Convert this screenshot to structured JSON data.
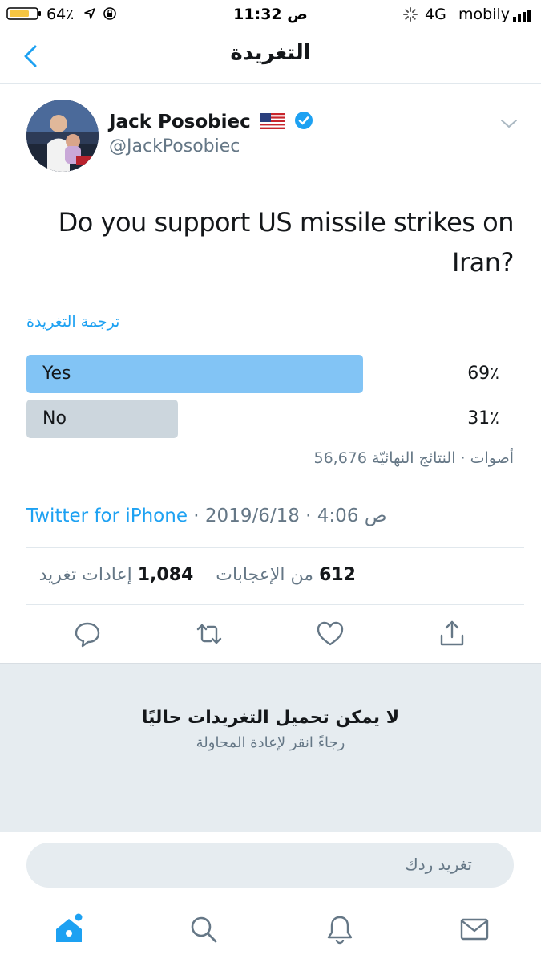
{
  "status_bar": {
    "battery": "64٪",
    "time": "11:32 ص",
    "network": "4G",
    "carrier": "mobily"
  },
  "nav": {
    "title": "التغريدة"
  },
  "tweet": {
    "author_name": "Jack Posobiec",
    "flag": "🇺🇸",
    "handle": "@JackPosobiec",
    "text": "Do you support US missile strikes on Iran?",
    "translate_label": "ترجمة التغريدة",
    "poll": {
      "options": [
        {
          "label": "Yes",
          "percent_text": "69٪",
          "percent": 69,
          "color": "#82c4f5"
        },
        {
          "label": "No",
          "percent_text": "31٪",
          "percent": 31,
          "color": "#ccd6dd"
        }
      ],
      "meta": "56,676 أصوات · النتائج النهائيّة"
    },
    "source": {
      "client": "Twitter for iPhone",
      "date": "2019/6/18",
      "time": "4:06 ص"
    },
    "stats": {
      "retweets_count": "1,084",
      "retweets_label": "إعادات تغريد",
      "likes_count": "612",
      "likes_label": "من الإعجابات"
    }
  },
  "load_error": {
    "title": "لا يمكن تحميل التغريدات حاليًا",
    "subtitle": "رجاءً انقر لإعادة المحاولة"
  },
  "reply": {
    "placeholder": "تغريد ردك"
  },
  "icons": {
    "accent": "#1da1f2",
    "verified": "#1da1f2",
    "action_gray": "#657786",
    "tabs": [
      "home-icon",
      "search-icon",
      "notifications-icon",
      "messages-icon"
    ]
  }
}
